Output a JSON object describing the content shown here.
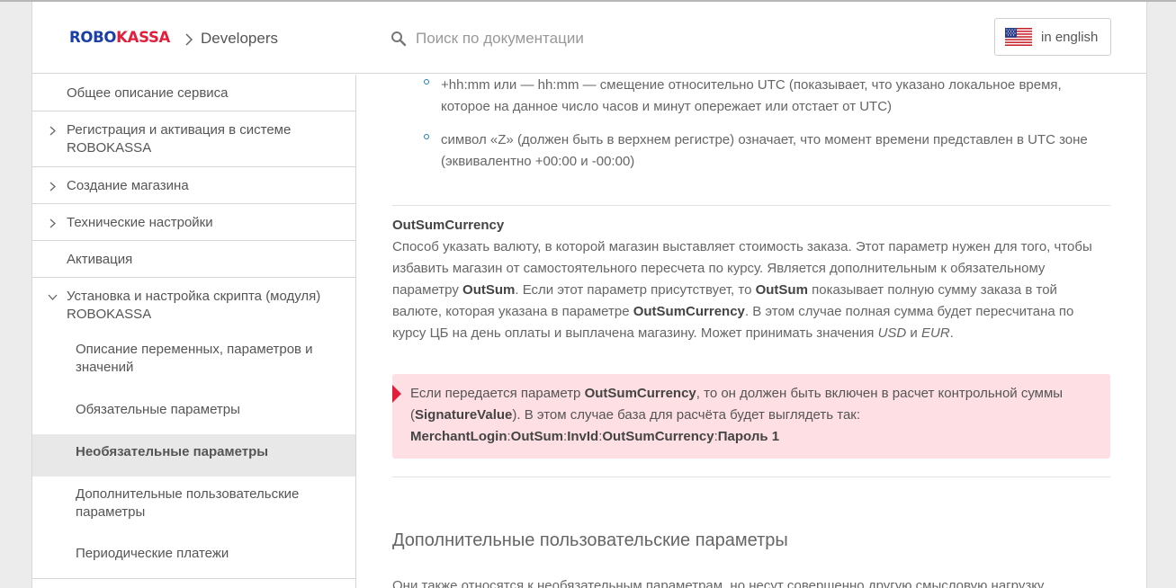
{
  "header": {
    "logo_robo": "ROBO",
    "logo_kassa": "KASSA",
    "crumb_sep": ">",
    "crumb": "Developers",
    "search_placeholder": "Поиск по документации",
    "language_label": "in english"
  },
  "sidebar": {
    "items": [
      {
        "label": "Общее описание сервиса"
      },
      {
        "label": "Регистрация и активация в системе ROBOKASSA"
      },
      {
        "label": "Создание магазина"
      },
      {
        "label": "Технические настройки"
      },
      {
        "label": "Активация"
      },
      {
        "label": "Установка и настройка скрипта (модуля) ROBOKASSA"
      }
    ],
    "sub_items": [
      {
        "label": "Описание переменных, параметров и значений"
      },
      {
        "label": "Обязательные параметры"
      },
      {
        "label": "Необязательные параметры"
      },
      {
        "label": "Дополнительные пользовательские параметры"
      },
      {
        "label": "Периодические платежи"
      }
    ]
  },
  "content": {
    "bullets": [
      "+hh:mm или — hh:mm — смещение относительно UTC (показывает, что указано локальное время, которое на данное число часов и минут опережает или отстает от UTC)",
      "символ «Z» (должен быть в верхнем регистре) означает, что момент времени представлен в UTC зоне (эквивалентно +00:00 и -00:00)"
    ],
    "param_title": "OutSumCurrency",
    "param_desc": {
      "t1": "Способ указать валюту, в которой магазин выставляет стоимость заказа. Этот параметр нужен для того, чтобы избавить магазин от самостоятельного пересчета по курсу. Является дополнительным к обязательному параметру ",
      "b1": "OutSum",
      "t2": ". Если этот параметр присутствует, то ",
      "b2": "OutSum",
      "t3": " показывает полную сумму заказа в той валюте, которая указана в параметре ",
      "b3": "OutSumCurrency",
      "t4": ". В этом случае полная сумма будет пересчитана по курсу ЦБ на день оплаты и выплачена магазину. Может принимать значения ",
      "i1": "USD",
      "t5": " и ",
      "i2": "EUR",
      "t6": "."
    },
    "notice": {
      "t1": "Если передается параметр ",
      "b1": "OutSumCurrency",
      "t2": ", то он должен быть включен в расчет  контрольной суммы (",
      "b2": "SignatureValue",
      "t3": ").  В этом случае база для  расчёта будет выглядеть так:",
      "f1": "MerchantLogin",
      "s1": ":",
      "f2": "OutSum",
      "s2": ":",
      "f3": "InvId",
      "s3": ":",
      "f4": "OutSumCurrency",
      "s4": ":",
      "f5": "Пароль 1"
    },
    "section_title": "Дополнительные пользовательские параметры",
    "section_intro": "Они также относятся к необязательным параметрам, но несут совершенно другую смысловую нагрузку"
  }
}
